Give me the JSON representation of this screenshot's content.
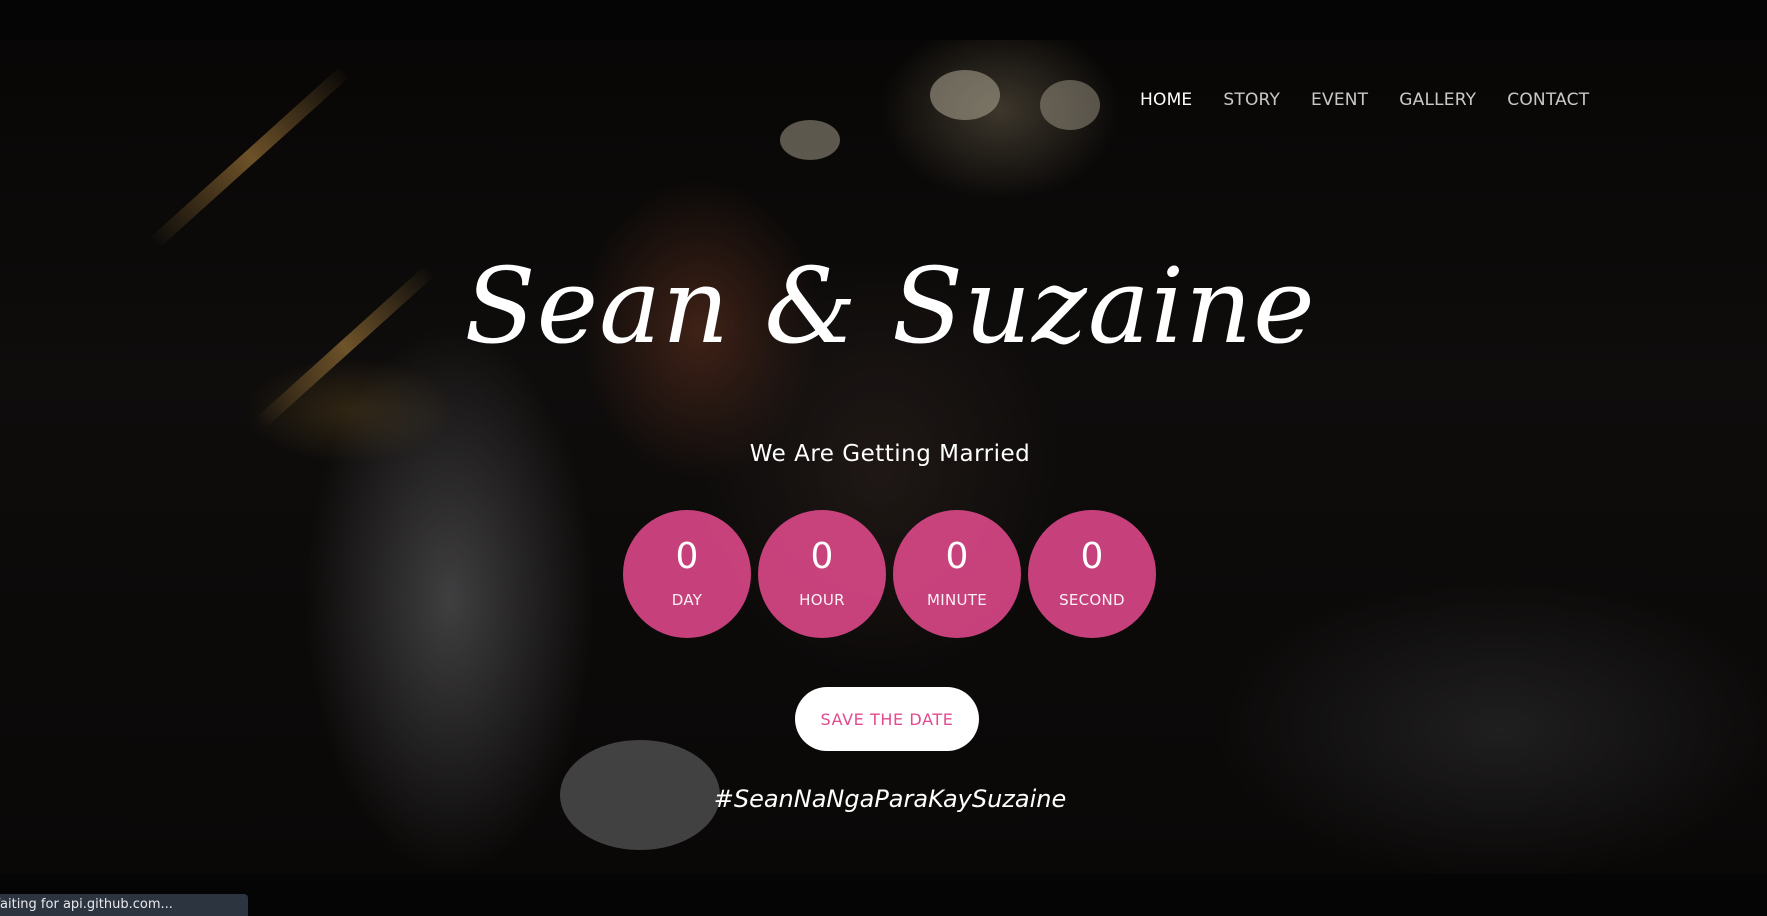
{
  "nav": {
    "items": [
      {
        "label": "HOME",
        "active": true
      },
      {
        "label": "STORY",
        "active": false
      },
      {
        "label": "EVENT",
        "active": false
      },
      {
        "label": "GALLERY",
        "active": false
      },
      {
        "label": "CONTACT",
        "active": false
      }
    ]
  },
  "hero": {
    "title": "Sean & Suzaine",
    "subtitle": "We Are Getting Married",
    "countdown": [
      {
        "value": "0",
        "label": "DAY"
      },
      {
        "value": "0",
        "label": "HOUR"
      },
      {
        "value": "0",
        "label": "MINUTE"
      },
      {
        "value": "0",
        "label": "SECOND"
      }
    ],
    "cta_label": "SAVE THE DATE",
    "hashtag": "#SeanNaNgaParaKaySuzaine"
  },
  "status_bar": {
    "text": "Waiting for api.github.com..."
  },
  "colors": {
    "accent": "#e84b8f",
    "text": "#ffffff",
    "background": "#050505"
  }
}
